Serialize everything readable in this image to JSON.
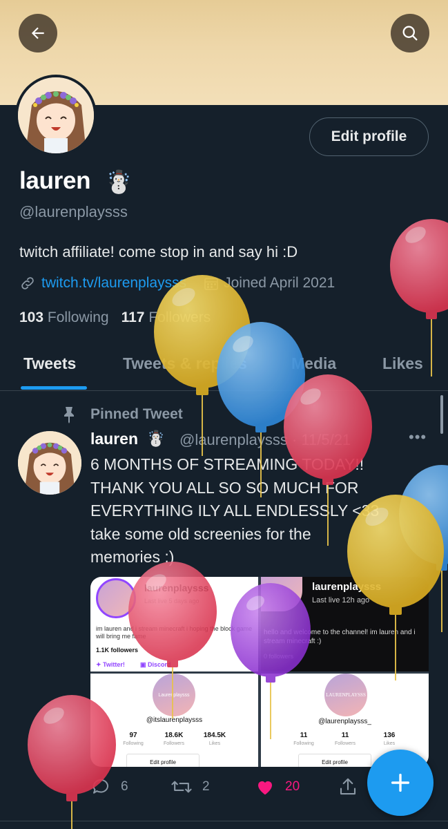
{
  "header": {
    "back_icon": "arrow-left-icon",
    "search_icon": "search-icon"
  },
  "profile": {
    "display_name": "lauren",
    "name_emoji": "☃️",
    "handle": "@laurenplaysss",
    "edit_profile_label": "Edit profile",
    "bio": "twitch affiliate! come stop in and say hi :D",
    "link_text": "twitch.tv/laurenplaysss",
    "joined_text": "Joined April 2021",
    "following_count": "103",
    "following_label": "Following",
    "followers_count": "117",
    "followers_label": "Followers"
  },
  "tabs": [
    {
      "label": "Tweets",
      "active": true
    },
    {
      "label": "Tweets & replies",
      "active": false
    },
    {
      "label": "Media",
      "active": false
    },
    {
      "label": "Likes",
      "active": false
    }
  ],
  "pinned_tweet": {
    "pinned_label": "Pinned Tweet",
    "author_name": "lauren",
    "author_emoji": "☃️",
    "author_handle_date": "@laurenplaysss · 11/5/21",
    "more_label": "•••",
    "text": "6 MONTHS OF STREAMING TODAY!!\nTHANK YOU ALL SO SO MUCH FOR\nEVERYTHING ILY ALL ENDLESSLY <33\ntake some old screenies for the\nmemories :)",
    "images": {
      "tl": {
        "name": "laurenplaysss",
        "status": "Last live 5 days ago",
        "bio": "im lauren and i stream minecraft i hoping the block game will bring me fame",
        "followers": "1.1K followers",
        "link1": "Twitter!",
        "link2": "Discord"
      },
      "tr": {
        "name": "laurenplaysss",
        "status": "Last live 12h ago",
        "bio": "hello and welcome to the channel! im lauren and i stream minecraft :)",
        "followers": "0 followers"
      },
      "bl": {
        "avatar_text": "Laurenplaysss",
        "handle": "@itslaurenplaysss",
        "stat1_value": "97",
        "stat1_label": "Following",
        "stat2_value": "18.6K",
        "stat2_label": "Followers",
        "stat3_value": "184.5K",
        "stat3_label": "Likes",
        "button": "Edit profile"
      },
      "br": {
        "avatar_text": "LAURENPLAYSSS",
        "handle": "@laurenplaysss_",
        "stat1_value": "11",
        "stat1_label": "Following",
        "stat2_value": "11",
        "stat2_label": "Followers",
        "stat3_value": "136",
        "stat3_label": "Likes",
        "button": "Edit profile"
      }
    },
    "replies": "6",
    "retweets": "2",
    "likes": "20"
  },
  "colors": {
    "background": "#15202b",
    "accent": "#1d9bf0",
    "like": "#f91880",
    "muted": "#8b98a5"
  }
}
